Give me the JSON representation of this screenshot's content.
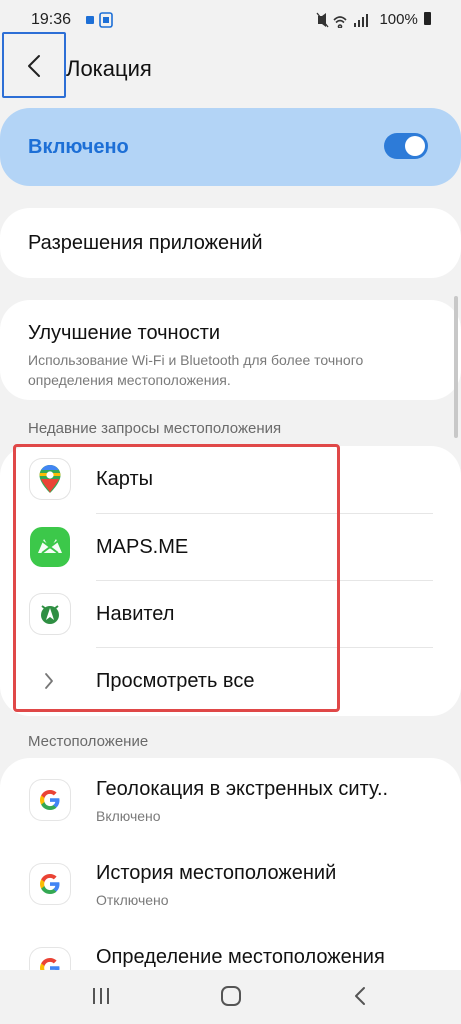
{
  "status": {
    "time": "19:36",
    "battery": "100%"
  },
  "header": {
    "title": "Локация"
  },
  "master": {
    "label": "Включено",
    "on": true
  },
  "permissions": {
    "label": "Разрешения приложений"
  },
  "accuracy": {
    "title": "Улучшение точности",
    "subtitle": "Использование Wi-Fi и Bluetooth для более точного определения местоположения."
  },
  "recent": {
    "section_label": "Недавние запросы местоположения",
    "items": [
      {
        "label": "Карты",
        "icon": "google-maps-icon"
      },
      {
        "label": "MAPS.ME",
        "icon": "mapsme-icon"
      },
      {
        "label": "Навител",
        "icon": "navitel-icon"
      }
    ],
    "view_all": "Просмотреть все"
  },
  "location": {
    "section_label": "Местоположение",
    "items": [
      {
        "label": "Геолокация в экстренных ситу..",
        "sub": "Включено",
        "icon": "google-icon"
      },
      {
        "label": "История местоположений",
        "sub": "Отключено",
        "icon": "google-icon"
      },
      {
        "label": "Определение местоположения",
        "sub": "",
        "icon": "google-icon"
      }
    ]
  },
  "colors": {
    "accent": "#1d6fd6",
    "master_bg": "#b3d4f6",
    "highlight": "#e04848"
  }
}
